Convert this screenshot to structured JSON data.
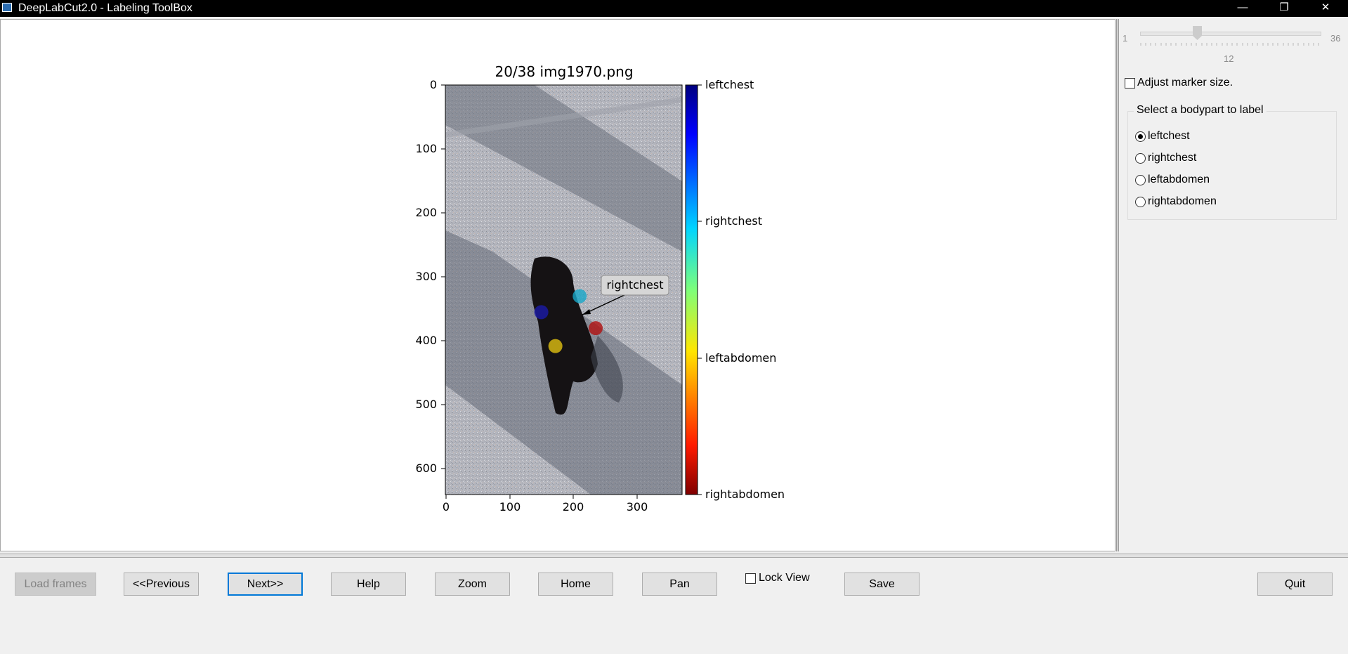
{
  "window": {
    "title": "DeepLabCut2.0 - Labeling ToolBox",
    "minimize": "—",
    "maximize": "❐",
    "close": "✕"
  },
  "plot": {
    "title": "20/38 img1970.png",
    "yticks": [
      "0",
      "100",
      "200",
      "300",
      "400",
      "500",
      "600"
    ],
    "xticks": [
      "0",
      "100",
      "200",
      "300"
    ],
    "colorbar_labels": [
      "leftchest",
      "rightchest",
      "leftabdomen",
      "rightabdomen"
    ],
    "annotation_label": "rightchest",
    "markers": [
      {
        "bodypart": "leftchest",
        "x": 150,
        "y": 355,
        "color": "#1a1aa8"
      },
      {
        "bodypart": "rightchest",
        "x": 210,
        "y": 330,
        "color": "#18a8c8"
      },
      {
        "bodypart": "leftabdomen",
        "x": 172,
        "y": 408,
        "color": "#e0c010"
      },
      {
        "bodypart": "rightabdomen",
        "x": 235,
        "y": 380,
        "color": "#b01010"
      }
    ]
  },
  "side_panel": {
    "slider_min": "1",
    "slider_max": "36",
    "slider_value": "12",
    "adjust_marker_label": "Adjust marker size.",
    "group_title": "Select a bodypart to label",
    "bodyparts": [
      {
        "label": "leftchest",
        "checked": true
      },
      {
        "label": "rightchest",
        "checked": false
      },
      {
        "label": "leftabdomen",
        "checked": false
      },
      {
        "label": "rightabdomen",
        "checked": false
      }
    ]
  },
  "toolbar": {
    "load_frames": "Load frames",
    "previous": "<<Previous",
    "next": "Next>>",
    "help": "Help",
    "zoom": "Zoom",
    "home": "Home",
    "pan": "Pan",
    "lock_view": "Lock View",
    "save": "Save",
    "quit": "Quit"
  }
}
